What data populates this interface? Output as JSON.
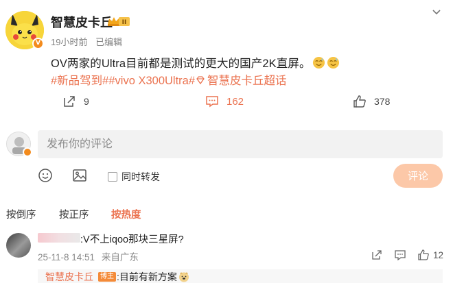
{
  "post": {
    "author": "智慧皮卡丘",
    "time": "19小时前",
    "edited": "已编辑",
    "text": "OV两家的Ultra目前都是测试的更大的国产2K直屏。",
    "tags": [
      "#新品驾到#",
      "#vivo X300Ultra#",
      "智慧皮卡丘超话"
    ],
    "emojis": [
      "sweat-smile-emoji",
      "sweat-smile-emoji"
    ]
  },
  "actions": {
    "forward_count": "9",
    "comment_count": "162",
    "like_count": "378"
  },
  "composer": {
    "placeholder": "发布你的评论",
    "repost_label": "同时转发",
    "submit_label": "评论"
  },
  "sort": {
    "reverse": "按倒序",
    "forward": "按正序",
    "hot": "按热度"
  },
  "comments": [
    {
      "text": ":V不上iqoo那块三星屏?",
      "date": "25-11-8 14:51",
      "location": "来自广东",
      "likes": "12",
      "reply": {
        "author": "智慧皮卡丘",
        "badge": "博主",
        "text": ":目前有新方案"
      }
    }
  ],
  "colors": {
    "accent": "#eb7350",
    "vip_badge": "#f38b1d",
    "input_bg": "#f2f2f2",
    "submit_disabled": "#fcc8a8"
  }
}
